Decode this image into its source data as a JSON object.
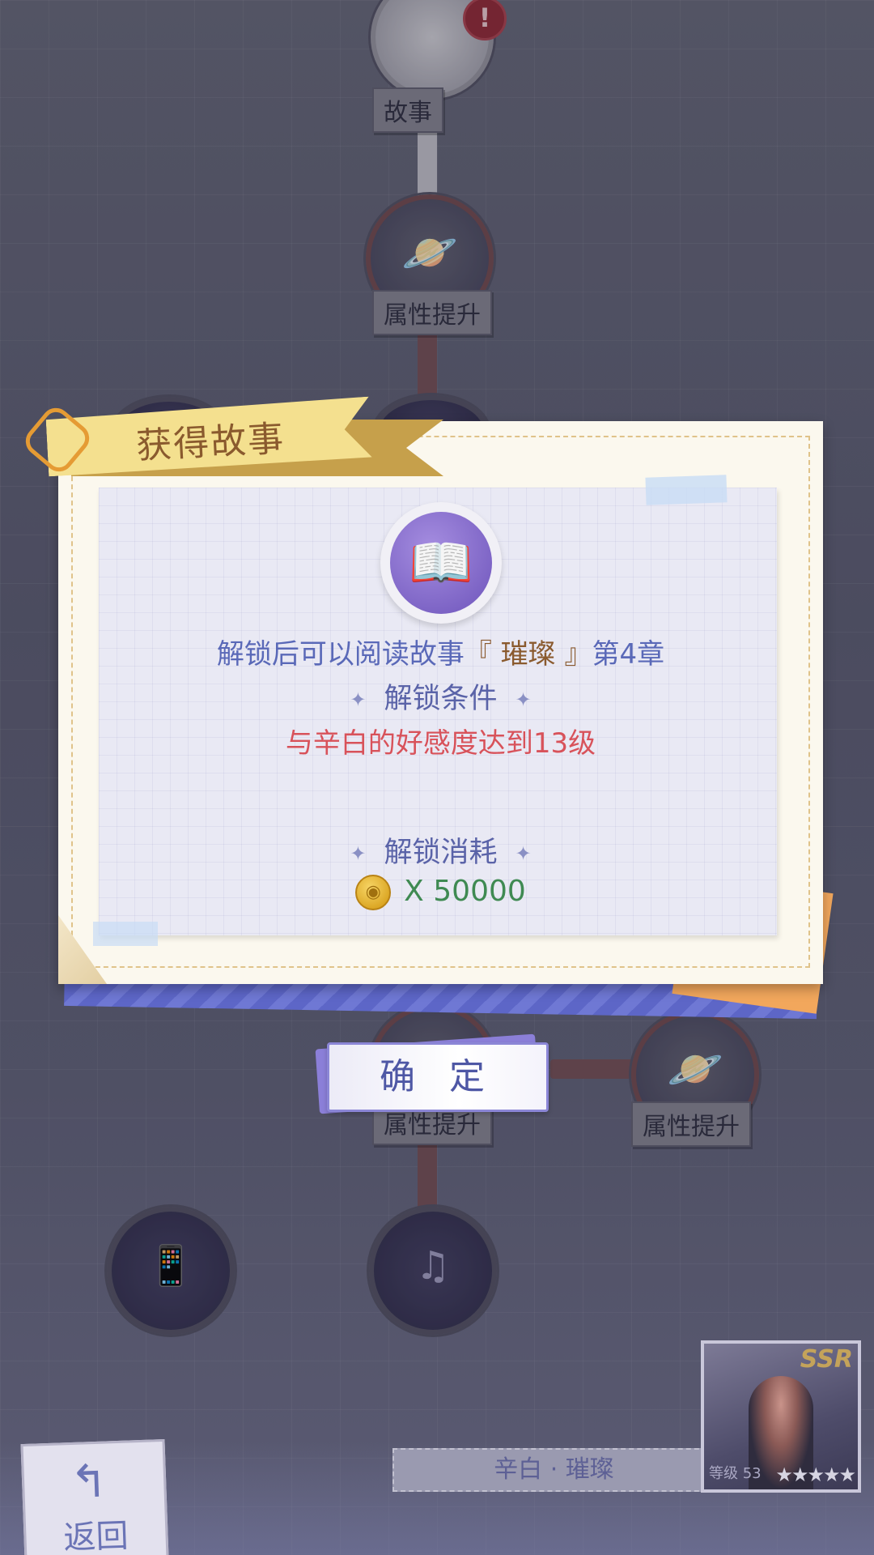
{
  "background_nodes": {
    "story": {
      "label": "故事",
      "alert": "!"
    },
    "attr_upgrade_top": {
      "label": "属性提升"
    },
    "attr_upgrade_mid": {
      "label": "属性提升"
    },
    "attr_upgrade_right": {
      "label": "属性提升"
    }
  },
  "dialog": {
    "title": "获得故事",
    "description_prefix": "解锁后可以阅读故事",
    "story_name": "『 璀璨 』",
    "description_suffix": "第4章",
    "condition_title": "解锁条件",
    "condition_text": "与辛白的好感度达到13级",
    "cost_title": "解锁消耗",
    "cost_amount": "X 50000"
  },
  "confirm_button": {
    "label": "确 定"
  },
  "footer": {
    "back_label": "返回",
    "card_name": "辛白 · 璀璨",
    "card_rarity": "SSR",
    "card_level": "等级  53",
    "card_stars": "★★★★★"
  },
  "colors": {
    "accent": "#5a69b8",
    "condition": "#d8525a",
    "cost": "#3f8a52",
    "story": "#8a5a2e"
  }
}
